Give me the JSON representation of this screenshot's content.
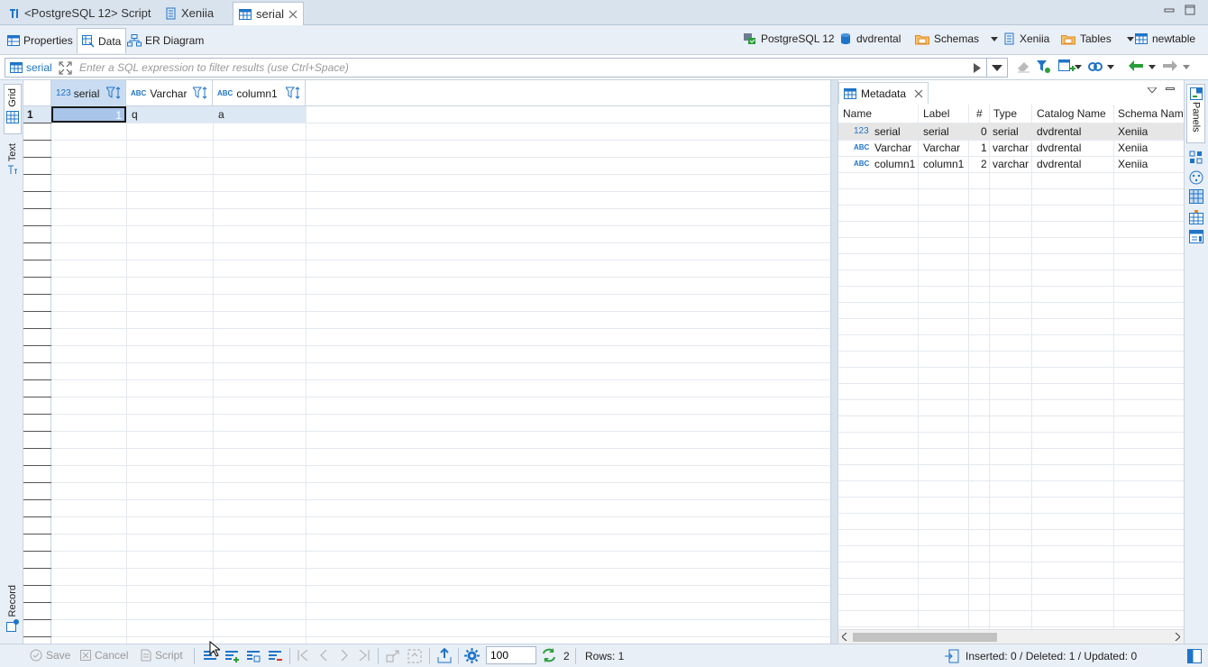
{
  "editor_tabs": [
    {
      "label": "<PostgreSQL 12> Script",
      "icon": "sql-script-icon"
    },
    {
      "label": "Xeniia",
      "icon": "schema-icon"
    },
    {
      "label": "serial",
      "icon": "table-icon",
      "active": true
    }
  ],
  "sub_tabs": [
    {
      "label": "Properties",
      "icon": "properties-icon"
    },
    {
      "label": "Data",
      "icon": "data-icon",
      "active": true
    },
    {
      "label": "ER Diagram",
      "icon": "er-diagram-icon"
    }
  ],
  "breadcrumb": {
    "connection": "PostgreSQL 12",
    "database": "dvdrental",
    "schemas": "Schemas",
    "schema": "Xeniia",
    "tables": "Tables",
    "table": "newtable"
  },
  "filter": {
    "entity_label": "serial",
    "placeholder": "Enter a SQL expression to filter results (use Ctrl+Space)"
  },
  "left_strip": {
    "grid": "Grid",
    "text": "Text",
    "record": "Record"
  },
  "grid": {
    "columns": [
      {
        "type_badge": "123",
        "name": "serial"
      },
      {
        "type_badge": "ABC",
        "name": "Varchar"
      },
      {
        "type_badge": "ABC",
        "name": "column1"
      }
    ],
    "rows": [
      {
        "num": "1",
        "cells": [
          "1",
          "q",
          "a"
        ]
      }
    ]
  },
  "metadata": {
    "tab_label": "Metadata",
    "headers": [
      "Name",
      "Label",
      "#",
      "Type",
      "Catalog Name",
      "Schema Nam"
    ],
    "rows": [
      {
        "badge": "123",
        "name": "serial",
        "label": "serial",
        "index": "0",
        "type": "serial",
        "catalog": "dvdrental",
        "schema": "Xeniia"
      },
      {
        "badge": "ABC",
        "name": "Varchar",
        "label": "Varchar",
        "index": "1",
        "type": "varchar",
        "catalog": "dvdrental",
        "schema": "Xeniia"
      },
      {
        "badge": "ABC",
        "name": "column1",
        "label": "column1",
        "index": "2",
        "type": "varchar",
        "catalog": "dvdrental",
        "schema": "Xeniia"
      }
    ]
  },
  "right_strip": {
    "panels": "Panels"
  },
  "bottom": {
    "save": "Save",
    "cancel": "Cancel",
    "script": "Script",
    "fetch_size": "100",
    "refresh_count": "2",
    "rows": "Rows: 1",
    "stats": "Inserted: 0 / Deleted: 1 / Updated: 0"
  },
  "colors": {
    "accent": "#1f74c8",
    "selection": "#dde8f5",
    "green": "#2a9d3a",
    "orange": "#e08a1e"
  }
}
